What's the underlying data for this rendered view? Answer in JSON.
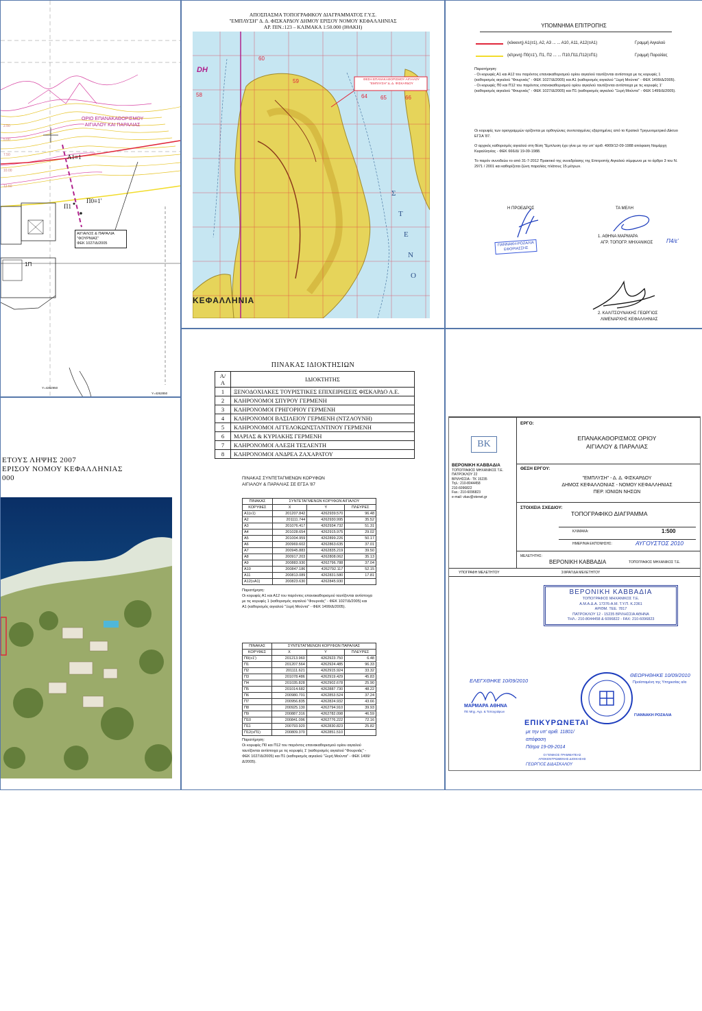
{
  "topo": {
    "labels": {
      "limit_title_1": "ΟΡΙΟ ΕΠΑΝΑΚΑΘΟΡΙΣΜΟΥ",
      "limit_title_2": "ΑΙΓΙΑΛΟΥ ΚΑΙ ΠΑΡΑΛΙΑΣ",
      "a1": "A1≡1",
      "p1": "Π1",
      "p0": "Π0≡1'",
      "box_1": "ΑΙΓΙΑΛΟΣ & ΠΑΡΑΛΙΑ",
      "box_2": "\"ΦΟΥΡΝΙΑΣ\"",
      "box_3": "ΦΕΚ 1027/Δ/2005",
      "building": "1Π",
      "contours": [
        "2.50",
        "5.00",
        "7.50",
        "10.00",
        "12.50"
      ],
      "grid_x1": "X=200200",
      "grid_x2": "Y=4262850",
      "grid_y": "Y=4262950"
    }
  },
  "map": {
    "title_1": "ΑΠΟΣΠΑΣΜΑ ΤΟΠΟΓΡΑΦΙΚΟΥ ΔΙΑΓΡΑΜΜΑΤΟΣ Γ.Υ.Σ.",
    "title_2": "\"ΕΜΠΛΥΣΗ\" Δ. Δ. ΦΙΣΚΑΡΔΟΥ ΔΗΜΟΥ ΕΡΙΣΟΥ ΝΟΜΟΥ ΚΕΦΑΛΛΗΝΙΑΣ",
    "title_3": "ΑΡ. ΠΙΝ.:123 – ΚΛΙΜΑΚΑ 1:50.000 (ΙΘΑΚΗ)",
    "grid_label": "DH",
    "callout_1": "ΘΕΣΗ ΕΠΑΝΑΚΑΘΟΡΙΣΜΟΥ ΑΙΓΙΑΛΟΥ",
    "callout_2": "\"ΕΜΠΛΥΣΗ\" Δ. Δ. ΦΙΣΚΑΡΔΟΥ",
    "place_1": "ΚΕΦΑΛΛΗΝΙΑ",
    "sea_letters": [
      "Σ",
      "Τ",
      "Ε",
      "Ν",
      "Ο"
    ],
    "grid_numbers": [
      "58",
      "59",
      "60",
      "61",
      "62",
      "63",
      "64",
      "65",
      "66",
      "67",
      "68"
    ]
  },
  "legend": {
    "title": "ΥΠΟΜΝΗΜΑ ΕΠΙΤΡΟΠΗΣ",
    "line1_desc": "(κόκκινη)  Α1(≡1), Α2, Α3 ... ... Α10, Α11, Α12(≡Α1)",
    "line1_name": "Γραμμή Αιγιαλού",
    "line1_color": "#e0263a",
    "line2_desc": "(κίτρινη)  Π0(≡1'), Π1, Π2 ... ... Π10,Π11,Π12(≡Π1)",
    "line2_name": "Γραμμή Παραλίας",
    "line2_color": "#f2dc2b",
    "note_head": "Παρατήρηση:",
    "note_1": "-  Οι κορυφές Α1 και Α12 του παρόντος επανακαθορισμού ορίου αιγιαλού ταυτίζονται αντίστοιχα με τις κορυφές 1 (καθορισμός αιγιαλού \"Φουρνιάς\" - ΦΕΚ 1027/Δ/2005) και Α1 (καθορισμός αιγιαλού \"Ξερή Μούντα\" - ΦΕΚ 1499/Δ/2005).",
    "note_2": "-  Οι κορυφές Π0 και Π12 του παρόντος επανακαθορισμού ορίου αιγιαλού ταυτίζονται αντίστοιχα με τις κορυφές 1' (καθορισμός αιγιαλού \"Φουρνιάς\" - ΦΕΚ 1027/Δ/2005) και Π1 (καθορισμός αιγιαλού \"Ξερή Μούντα\" - ΦΕΚ 1499/Δ/2005).",
    "para_1": "Οι κορυφές των οριογραμμών ορίζονται με ορθογώνιες συντεταγμένες εξαρτημένες από το Κρατικό Τριγωνομετρικό Δίκτυο ΕΓΣΑ '87.",
    "para_2": "Ο αρχικός καθορισμός αιγιαλού στη θέση 'Έμπλυση έχει γίνει με την υπ' αριθ. 4909/12-09-1988 απόφαση Νομάρχη Κεφαλληνίας - ΦΕΚ 666/Δ/ 19-09-1988.",
    "para_3": "Το παρόν συνοδεύει το από 31-7-2012 Πρακτικό της συνεδρίασης της Επιτροπής Αιγιαλού σύμφωνα με το άρθρο 3 του Ν. 2971 / 2001 και καθορίζεται ζώνη παραλίας πλάτους 15 μέτρων.",
    "president_label": "Η ΠΡΟΕΔΡΟΣ",
    "members_label": "ΤΑ ΜΕΛΗ",
    "member_1": "1. ΑΘΗΝΑ ΜΑΡΜΑΡΑ",
    "member_1_role": "ΑΓΡ. ΤΟΠΟΓΡ. ΜΗΧΑΝΙΚΟΣ",
    "president_stamp_1": "ΓΙΑΝΝΑΚΗ-ΡΟΖΑΛΙΑ",
    "president_stamp_2": "ΕΦΟΡΙΑΣΣΗΣ",
    "member_2": "2. ΚΑΛΙΤΣΟΥΝΑΚΗΣ ΓΕΩΡΓΙΟΣ",
    "member_2_role": "ΛΙΜΕΝΑΡΧΗΣ ΚΕΦΑΛΛΗΝΙΑΣ",
    "handwritten_code": "Π4/ε'"
  },
  "ortho": {
    "line_1": "ΕΤΟΥΣ ΛΗΨΗΣ 2007",
    "line_2": "ΕΡΙΣΟΥ ΝΟΜΟΥ ΚΕΦΑΛΛΗΝΙΑΣ",
    "line_3": "000"
  },
  "ownership": {
    "title": "ΠΙΝΑΚΑΣ ΙΔΙΟΚΤΗΣΙΩΝ",
    "col_aa": "Α/Α",
    "col_owner": "ΙΔΙΟΚΤΗΤΗΣ",
    "rows": [
      {
        "n": "1",
        "owner": "ΞΕΝΟΔΟΧΙΑΚΕΣ ΤΟΥΡΙΣΤΙΚΕΣ ΕΠΙΧΕΙΡΗΣΕΙΣ ΦΙΣΚΑΡΔΟ Α.Ε."
      },
      {
        "n": "2",
        "owner": "ΚΛΗΡΟΝΟΜΟΙ ΣΠΥΡΟΥ ΓΕΡΜΕΝΗ"
      },
      {
        "n": "3",
        "owner": "ΚΛΗΡΟΝΟΜΟΙ ΓΡΗΓΟΡΙΟΥ ΓΕΡΜΕΝΗ"
      },
      {
        "n": "4",
        "owner": "ΚΛΗΡΟΝΟΜΟΙ ΒΑΣΙΛΕΙΟΥ ΓΕΡΜΕΝΗ (ΝΤΖΑΟΥΝΗ)"
      },
      {
        "n": "5",
        "owner": "ΚΛΗΡΟΝΟΜΟΙ ΑΓΓΕΛΟΚΩΝΣΤΑΝΤΙΝΟΥ ΓΕΡΜΕΝΗ"
      },
      {
        "n": "6",
        "owner": "ΜΑΡΙΑΣ & ΚΥΡΙΑΚΗΣ ΓΕΡΜΕΝΗ"
      },
      {
        "n": "7",
        "owner": "ΚΛΗΡΟΝΟΜΟΙ ΑΛΕΞΗ ΤΕΣΑΕΝΤΗ"
      },
      {
        "n": "8",
        "owner": "ΚΛΗΡΟΝΟΜΟΙ ΑΝΔΡΕΑ ΖΑΧΑΡΑΤΟΥ"
      }
    ],
    "coords_title_1": "ΠΙΝΑΚΑΣ ΣΥΝΤΕΤΑΓΜΕΝΩΝ ΚΟΡΥΦΩΝ",
    "coords_title_2": "ΑΙΓΙΑΛΟΥ & ΠΑΡΑΛΙΑΣ ΣΕ ΕΓΣΑ '87",
    "aigialos": {
      "h_label": "ΠΙΝΑΚΑΣ",
      "h_title": "ΣΥΝΤΕΤΑΓΜΕΝΩΝ ΚΟΡΥΦΩΝ ΑΙΓΙΑΛΟΥ",
      "cols": [
        "ΚΟΡΥΦΕΣ",
        "X",
        "Y",
        "ΠΛΕΥΡΕΣ"
      ],
      "rows": [
        [
          "A1(≡1)",
          "201207.842",
          "4262939.570",
          "96.48"
        ],
        [
          "A2",
          "201111.744",
          "4262930.995",
          "35.52"
        ],
        [
          "A3",
          "201076.417",
          "4262934.732",
          "51.31"
        ],
        [
          "A4",
          "201028.654",
          "4262915.975",
          "29.02"
        ],
        [
          "A5",
          "201004.959",
          "4262899.226",
          "50.17"
        ],
        [
          "A6",
          "200969.602",
          "4262863.635",
          "37.01"
        ],
        [
          "A7",
          "200945.883",
          "4262835.219",
          "39.50"
        ],
        [
          "A8",
          "200917.203",
          "4262808.062",
          "35.13"
        ],
        [
          "A9",
          "200883.930",
          "4262796.788",
          "37.04"
        ],
        [
          "A10",
          "200847.186",
          "4262792.117",
          "52.15"
        ],
        [
          "A11",
          "200813.089",
          "4262831.580",
          "17.81"
        ],
        [
          "A12(≡A1)",
          "200823.630",
          "4262845.930",
          ""
        ]
      ],
      "note_head": "Παρατήρηση:",
      "note": "Οι κορυφές Α1 και Α12 του παρόντος επανακαθορισμού ταυτίζονται αντίστοιχα με τις κορυφές 1 (καθορισμός αιγιαλού \"Φουρνιάς\" - ΦΕΚ 1027/Δ/2005) και Α1 (καθορισμός αιγιαλού \"Ξερή Μούντα\" - ΦΕΚ 1499/Δ/2005)."
    },
    "paralia": {
      "h_label": "ΠΙΝΑΚΑΣ",
      "h_title": "ΣΥΝΤΕΤΑΓΜΕΝΩΝ ΚΟΡΥΦΩΝ ΠΑΡΑΛΙΑΣ",
      "cols": [
        "ΚΟΡΥΦΕΣ",
        "X",
        "Y",
        "ΠΛΕΥΡΕΣ"
      ],
      "rows": [
        [
          "Π0(≡1')",
          "201213.960",
          "4262923.750",
          "6.48"
        ],
        [
          "Π1",
          "201207.564",
          "4262924.485",
          "96.33"
        ],
        [
          "Π2",
          "201111.621",
          "4262915.924",
          "33.32"
        ],
        [
          "Π3",
          "201078.486",
          "4262919.429",
          "45.83"
        ],
        [
          "Π4",
          "201035.828",
          "4262902.678",
          "25.90"
        ],
        [
          "Π5",
          "201014.682",
          "4262887.730",
          "48.22"
        ],
        [
          "Π6",
          "200980.701",
          "4262853.524",
          "37.24"
        ],
        [
          "Π7",
          "200956.835",
          "4262824.932",
          "43.66"
        ],
        [
          "Π8",
          "200925.130",
          "4262794.910",
          "39.93"
        ],
        [
          "Π9",
          "200887.316",
          "4262782.098",
          "46.59"
        ],
        [
          "Π10",
          "200841.096",
          "4262776.222",
          "72.16"
        ],
        [
          "Π11",
          "200793.920",
          "4262830.823",
          "25.82"
        ],
        [
          "Π12(≡Π1)",
          "200809.370",
          "4262851.510",
          ""
        ]
      ],
      "note_head": "Παρατήρηση:",
      "note": "Οι κορυφές Π0 και Π12 του παρόντος επανακαθορισμού ορίου αιγιαλού ταυτίζονται αντίστοιχα με τις κορυφές 1' (καθορισμός αιγιαλού \"Φουρνιάς\" - ΦΕΚ 1027/Δ/2005) και Π1 (καθορισμός αιγιαλού \"Ξερή Μούντα\" - ΦΕΚ 1499/Δ/2005)."
    }
  },
  "titleblock": {
    "logo": "BK",
    "firm": "ΒΕΡΟΝΙΚΗ ΚΑΒΒΑΔΙΑ",
    "firm_sub": "ΤΟΠΟΓΡΑΦΟΣ ΜΗΧΑΝΙΚΟΣ Τ.Ε.",
    "firm_addr_1": "ΠΑΤΡΟΚΛΟΥ 22",
    "firm_addr_2": "ΒΡΙΛΗΣΣΙΑ - ΤΚ 15235",
    "firm_tel": "Τηλ.: 210-8044458",
    "firm_tel2": "210-6096822",
    "firm_fax": "Fax.: 210-6096823",
    "firm_email": "e-mail: vkav@otenet.gr",
    "ergo_label": "ΕΡΓΟ:",
    "ergo_1": "ΕΠΑΝΑΚΑΘΟΡΙΣΜΟΣ ΟΡΙΟΥ",
    "ergo_2": "ΑΙΓΙΑΛΟΥ & ΠΑΡΑΛΙΑΣ",
    "thesi_label": "ΘΕΣΗ ΕΡΓΟΥ:",
    "thesi_1": "\"ΕΜΠΛΥΣΗ\" - Δ. Δ. ΦΙΣΚΑΡΔΟΥ",
    "thesi_2": "ΔΗΜΟΣ ΚΕΦΑΛΛΟΝΙΑΣ - ΝΟΜΟΥ ΚΕΦΑΛΛΗΝΙΑΣ",
    "thesi_3": "ΠΕΡ. ΙΟΝΙΩΝ ΝΗΣΩΝ",
    "stoixeia_label": "ΣΤΟΙΧΕΙΑ ΣΧΕΔΙΟΥ:",
    "drawing": "ΤΟΠΟΓΡΑΦΙΚΟ ΔΙΑΓΡΑΜΜΑ",
    "scale_label": "ΚΛΙΜΑΚΑ:",
    "scale": "1:500",
    "date_label": "ΗΜΕΡ/ΝΙΑ ΕΚΠΟΝΗΣΗΣ:",
    "date": "ΑΥΓΟΥΣΤΟΣ 2010",
    "meletitis_label": "ΜΕΛΕΤΗΤΗΣ:",
    "meletitis": "ΒΕΡΟΝΙΚΗ ΚΑΒΒΑΔΙΑ",
    "meletitis_sub": "ΤΟΠΟΓΡΑΦΟΣ ΜΗΧΑΝΙΚΟΣ Τ.Ε.",
    "sign_label": "ΥΠΟΓΡΑΦΗ ΜΕΛΕΤΗΤΟΥ",
    "seal_label": "ΣΦΡΑΓΙΔΑ ΜΕΛΕΤΗΤΟΥ",
    "stamp_1": "ΒΕΡΟΝΙΚΗ ΚΑΒΒΑΔΙΑ",
    "stamp_2": "ΤΟΠΟΓΡΑΦΟΣ ΜΗΧΑΝΙΚΟΣ Τ.Ε.",
    "stamp_3": "Α.Μ.Α.Δ.Α. 17376-Α.Μ. Τ.Υ.Π. Κ.2361",
    "stamp_4": "ΑΡΙΘΜ. ΤΕΕ. 7817",
    "stamp_5": "ΠΑΤΡΟΚΛΟΥ 12 - 15235 ΒΡΙΛΗΣΣΙΑ ΑΘΗΝΑ",
    "stamp_6": "ΤΗΛ.: 210-8044458 & 6096822 - FAX: 210-6096823",
    "checked": "ΕΛΕΓΧΘΗΚΕ 10/09/2010",
    "checker": "ΜΑΡΜΑΡΑ ΑΘΗΝΑ",
    "checker_role": "ΠΕ Μηχ. Αγρ. & Τοπογράφων",
    "certified": "ΘΕΩΡΗΘΗΚΕ 10/09/2010",
    "certified_2": "Προϊσταμένη της Υπηρεσίας α/α",
    "ratified": "ΕΠΙΚΥΡΩΝΕΤΑΙ",
    "ratified_2": "με την υπ' αριθ. 11801/",
    "ratified_3": "απόφαση",
    "ratified_4": "Πάτρα 19-09-2014",
    "gen_sec_1": "Ο ΓΕΝΙΚΟΣ ΓΡΑΜΜΑΤΕΑΣ",
    "gen_sec_2": "ΑΠΟΚΕΝΤΡΩΜΕΝΗΣ ΔΙΟΙΚΗΣΗΣ",
    "gen_sec_name": "ΓΕΩΡΓΙΟΣ ΔΙΔΑΣΚΑΛΟΥ",
    "head_name": "ΓΙΑΝΝΑΚΗ ΡΟΖΑΛΙΑ"
  }
}
